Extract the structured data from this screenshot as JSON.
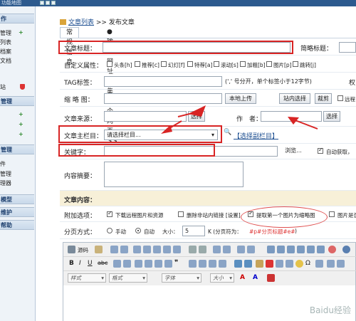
{
  "window": {
    "title": "功能地图"
  },
  "sidebar": {
    "items": [
      {
        "label": "作",
        "kind": "head"
      },
      {
        "label": "管理",
        "kind": "item"
      },
      {
        "label": "列表",
        "kind": "item"
      },
      {
        "label": "档案",
        "kind": "item"
      },
      {
        "label": "文档",
        "kind": "item"
      },
      {
        "label": "站",
        "kind": "item"
      },
      {
        "label": "管理",
        "kind": "head"
      },
      {
        "label": "管理",
        "kind": "head"
      },
      {
        "label": "件",
        "kind": "item"
      },
      {
        "label": "管理",
        "kind": "item"
      },
      {
        "label": "理器",
        "kind": "item"
      },
      {
        "label": "模型",
        "kind": "head"
      },
      {
        "label": "维护",
        "kind": "head"
      },
      {
        "label": "帮助",
        "kind": "head"
      }
    ]
  },
  "breadcrumb": {
    "link": "文章列表",
    "sep": ">>",
    "current": "发布文章"
  },
  "tabs": [
    {
      "label": "常规信息"
    },
    {
      "label": "●输入网址采集单个网页>>"
    }
  ],
  "form": {
    "title_label": "文章标题：",
    "short_title_label": "简略标题：",
    "custom_attr_label": "自定义属性：",
    "attrs": [
      "头条[h]",
      "推荐[c]",
      "幻灯[f]",
      "特荐[a]",
      "滚动[s]",
      "加粗[b]",
      "图片[p]",
      "跳转[j]"
    ],
    "tag_label": "TAG标签：",
    "tag_hint": "(',' 号分开，单个标签小于12字节)",
    "tag_right": "权",
    "thumb_label": "缩 略 图：",
    "upload_btn": "本地上传",
    "site_select_btn": "站内选择",
    "crop_btn": "裁剪",
    "remote_label": "远程",
    "source_label": "文章来源：",
    "select_btn": "选择",
    "author_label": "作　者：",
    "author_select_btn": "选择",
    "column_label": "文章主栏目：",
    "column_value": "请选择栏目...",
    "sub_column_link": "【选择副栏目】",
    "keyword_label": "关键字：",
    "browse_btn": "浏览...",
    "auto_fetch_label": "自动获取，",
    "summary_label": "内容摘要：",
    "content_label": "文章内容：",
    "addon_label": "附加选项：",
    "addon_opts": [
      {
        "label": "下载远程图片和资源",
        "checked": true
      },
      {
        "label": "删除非站内链接 [设置]",
        "checked": false
      },
      {
        "label": "提取第一个图片为缩略图",
        "checked": true
      },
      {
        "label": "图片是否",
        "checked": false
      }
    ],
    "paging_label": "分页方式：",
    "manual_label": "手动",
    "auto_label": "自动",
    "size_label": "大小：",
    "size_value": "5",
    "size_unit": "K (分页符为：",
    "page_tag": "#p#分页标题#e#",
    "page_tag_close": ")"
  },
  "editor": {
    "source_label": "源码",
    "style_placeholder": "样式",
    "format_placeholder": "格式",
    "font_placeholder": "字体",
    "size_placeholder": "大小"
  },
  "watermark": "Baidu经验",
  "colors": {
    "annotation": "#d82424",
    "link": "#1d4f91",
    "header": "#2d5a8e"
  }
}
